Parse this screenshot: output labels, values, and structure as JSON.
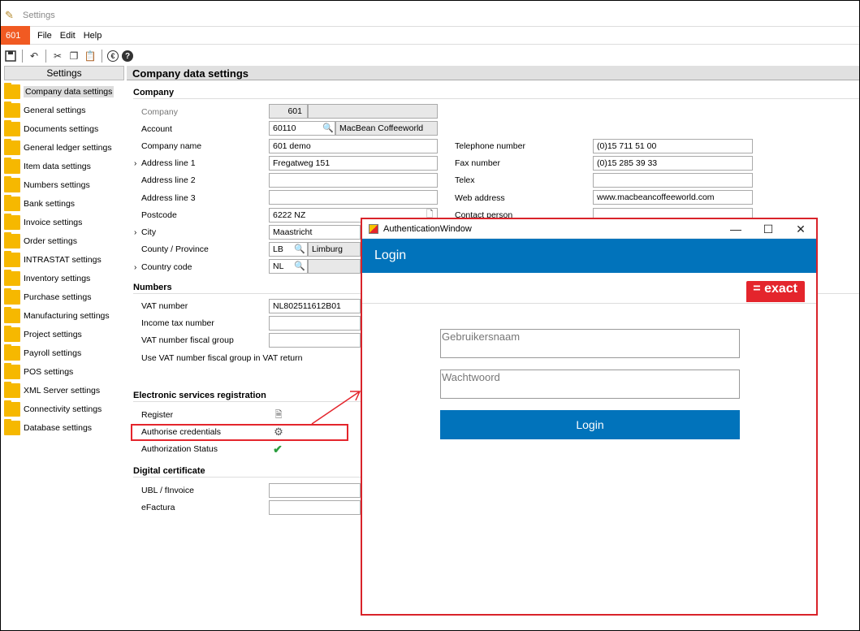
{
  "window": {
    "title": "Settings"
  },
  "menubar": {
    "badge": "601",
    "items": [
      "File",
      "Edit",
      "Help"
    ]
  },
  "toolbar": {
    "icons": [
      "save-icon",
      "undo-icon",
      "cut-icon",
      "copy-icon",
      "paste-icon",
      "euro-icon",
      "help-icon"
    ]
  },
  "sidebar": {
    "header": "Settings",
    "items": [
      "Company data settings",
      "General settings",
      "Documents settings",
      "General ledger settings",
      "Item data settings",
      "Numbers settings",
      "Bank settings",
      "Invoice settings",
      "Order settings",
      "INTRASTAT settings",
      "Inventory settings",
      "Purchase settings",
      "Manufacturing settings",
      "Project settings",
      "Payroll settings",
      "POS settings",
      "XML Server settings",
      "Connectivity settings",
      "Database settings"
    ],
    "selected_index": 0
  },
  "main": {
    "title": "Company data settings",
    "sections": {
      "company": "Company",
      "numbers": "Numbers",
      "electronic": "Electronic services registration",
      "certificate": "Digital certificate"
    },
    "company": {
      "company_label": "Company",
      "company_value": "601",
      "account_label": "Account",
      "account_value": "60110",
      "account_name": "MacBean Coffeeworld",
      "name_label": "Company name",
      "name_value": "601 demo",
      "addr1_label": "Address line 1",
      "addr1_value": "Fregatweg 151",
      "addr2_label": "Address line 2",
      "addr2_value": "",
      "addr3_label": "Address line 3",
      "addr3_value": "",
      "postcode_label": "Postcode",
      "postcode_value": "6222 NZ",
      "city_label": "City",
      "city_value": "Maastricht",
      "county_label": "County / Province",
      "county_code": "LB",
      "county_name": "Limburg",
      "country_label": "Country code",
      "country_value": "NL",
      "phone_label": "Telephone number",
      "phone_value": "(0)15 711 51 00",
      "fax_label": "Fax number",
      "fax_value": "(0)15 285 39 33",
      "telex_label": "Telex",
      "telex_value": "",
      "web_label": "Web address",
      "web_value": "www.macbeancoffeeworld.com",
      "contact_label": "Contact person"
    },
    "numbers": {
      "vat_label": "VAT number",
      "vat_value": "NL802511612B01",
      "income_label": "Income tax number",
      "vatgroup_label": "VAT number fiscal group",
      "usevat_label": "Use VAT number fiscal group in VAT return"
    },
    "electronic": {
      "register_label": "Register",
      "authorise_label": "Authorise credentials",
      "status_label": "Authorization Status"
    },
    "certificate": {
      "ubl_label": "UBL / fInvoice",
      "efactura_label": "eFactura"
    }
  },
  "auth_window": {
    "title": "AuthenticationWindow",
    "controls": {
      "minimize": "—",
      "maximize": "☐",
      "close": "✕"
    },
    "header": "Login",
    "logo": "= exact",
    "username_placeholder": "Gebruikersnaam",
    "password_placeholder": "Wachtwoord",
    "login_button": "Login"
  },
  "colors": {
    "accent_orange": "#f15a22",
    "auth_blue": "#0173bb",
    "highlight_red": "#e4252c",
    "folder_yellow": "#f6b800",
    "check_green": "#2a9d3e"
  }
}
